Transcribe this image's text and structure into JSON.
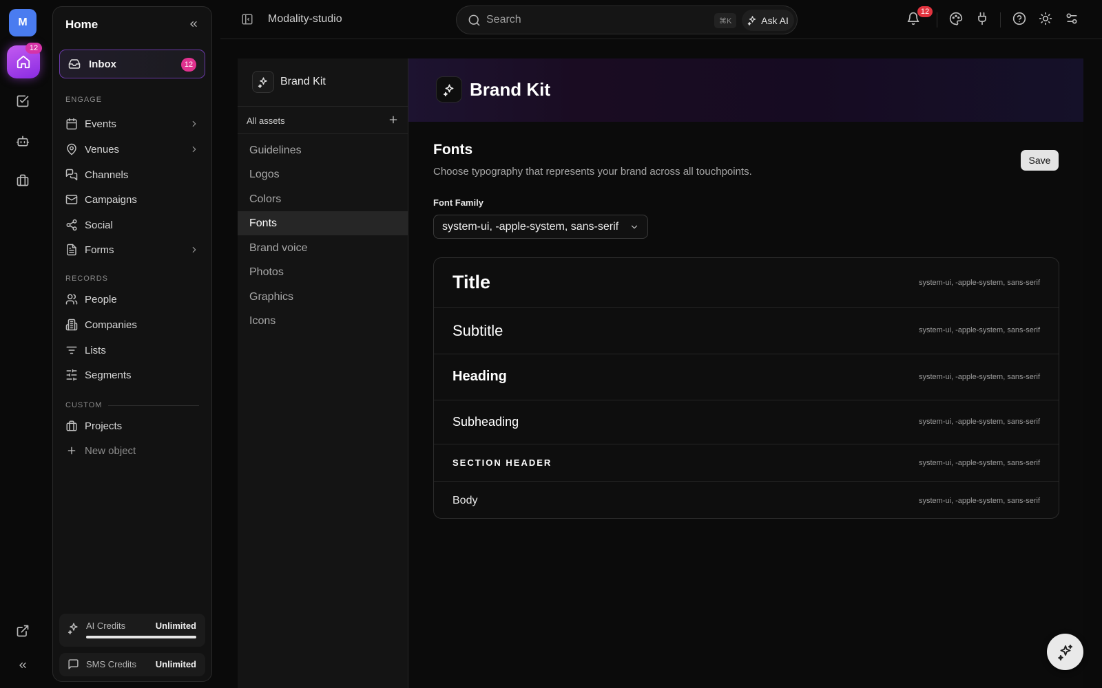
{
  "rail": {
    "avatar_initial": "M",
    "home_badge": "12",
    "icons": [
      "home-icon",
      "checkbox-icon",
      "bot-icon",
      "briefcase-icon",
      "external-link-icon",
      "double-chevron-left-icon"
    ]
  },
  "sidebar": {
    "title": "Home",
    "inbox": {
      "label": "Inbox",
      "badge": "12"
    },
    "sections": {
      "engage": "ENGAGE",
      "records": "RECORDS",
      "custom": "CUSTOM"
    },
    "engage_items": [
      {
        "label": "Events",
        "icon": "calendar-icon",
        "has_chevron": true
      },
      {
        "label": "Venues",
        "icon": "map-pin-icon",
        "has_chevron": true
      },
      {
        "label": "Channels",
        "icon": "chat-icon",
        "has_chevron": false
      },
      {
        "label": "Campaigns",
        "icon": "mail-icon",
        "has_chevron": false
      },
      {
        "label": "Social",
        "icon": "share-icon",
        "has_chevron": false
      },
      {
        "label": "Forms",
        "icon": "document-icon",
        "has_chevron": true
      }
    ],
    "records_items": [
      {
        "label": "People",
        "icon": "users-icon"
      },
      {
        "label": "Companies",
        "icon": "building-icon"
      },
      {
        "label": "Lists",
        "icon": "list-icon"
      },
      {
        "label": "Segments",
        "icon": "sliders-icon"
      }
    ],
    "custom_items": [
      {
        "label": "Projects",
        "icon": "briefcase-icon"
      }
    ],
    "new_object_label": "New object",
    "credits": {
      "ai": {
        "label": "AI Credits",
        "value": "Unlimited",
        "progress": 1.0
      },
      "sms": {
        "label": "SMS Credits",
        "value": "Unlimited"
      }
    }
  },
  "topbar": {
    "workspace": "Modality-studio",
    "search_placeholder": "Search",
    "shortcut": "⌘K",
    "ask_ai": "Ask AI",
    "notification_badge": "12"
  },
  "asset_panel": {
    "title": "Brand Kit",
    "subheader": "All assets",
    "items": [
      "Guidelines",
      "Logos",
      "Colors",
      "Fonts",
      "Brand voice",
      "Photos",
      "Graphics",
      "Icons"
    ],
    "active_index": 3
  },
  "main": {
    "hero_title": "Brand Kit",
    "section_title": "Fonts",
    "section_desc": "Choose typography that represents your brand across all touchpoints.",
    "save_label": "Save",
    "font_family_label": "Font Family",
    "font_family_value": "system-ui, -apple-system, sans-serif",
    "preview_rows": [
      {
        "name": "Title",
        "family": "system-ui, -apple-system, sans-serif"
      },
      {
        "name": "Subtitle",
        "family": "system-ui, -apple-system, sans-serif"
      },
      {
        "name": "Heading",
        "family": "system-ui, -apple-system, sans-serif"
      },
      {
        "name": "Subheading",
        "family": "system-ui, -apple-system, sans-serif"
      },
      {
        "name": "SECTION HEADER",
        "family": "system-ui, -apple-system, sans-serif"
      },
      {
        "name": "Body",
        "family": "system-ui, -apple-system, sans-serif"
      }
    ]
  },
  "colors": {
    "accent": "#8a2be2",
    "badge_pink": "#e0328f",
    "badge_red": "#e0333e",
    "avatar_blue": "#4a7cf0"
  }
}
